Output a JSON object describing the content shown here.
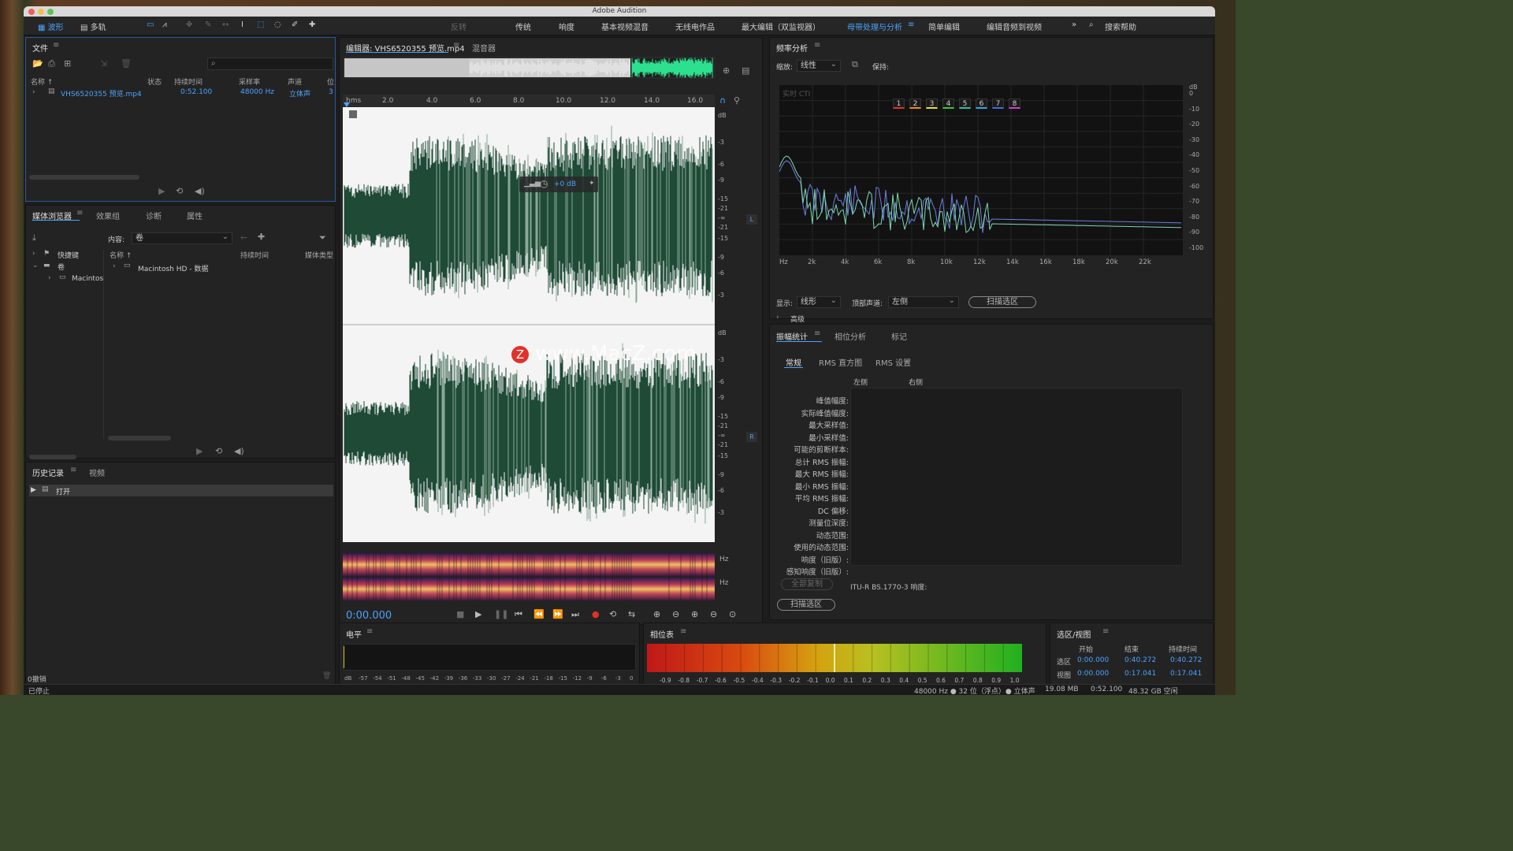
{
  "app_title": "Adobe Audition",
  "toolbar": {
    "waveform_label": "波形",
    "multitrack_label": "多轨",
    "reverse_label": "反转",
    "workspaces": [
      "传统",
      "响度",
      "基本视频混音",
      "无线电作品",
      "最大编辑（双监视器）",
      "母带处理与分析",
      "简单编辑",
      "编辑音频到视频"
    ],
    "active_workspace": "母带处理与分析",
    "overflow": "»",
    "search_placeholder": "搜索帮助"
  },
  "files_panel": {
    "title": "文件",
    "columns": [
      "名称 ↑",
      "状态",
      "持续时间",
      "采样率",
      "声道",
      "位"
    ],
    "rows": [
      {
        "name": "VHS6520355 预览.mp4",
        "status": "",
        "duration": "0:52.100",
        "rate": "48000 Hz",
        "channels": "立体声",
        "bits": "3"
      }
    ]
  },
  "media_browser": {
    "tabs": [
      "媒体浏览器",
      "效果组",
      "诊断",
      "属性"
    ],
    "content_label": "内容:",
    "content_value": "卷",
    "left_tree": [
      "快捷键",
      "卷",
      "Macintos"
    ],
    "columns": [
      "名称 ↑",
      "持续时间",
      "媒体类型"
    ],
    "rows": [
      "Macintosh HD - 数据"
    ]
  },
  "history_panel": {
    "tabs": [
      "历史记录",
      "视频"
    ],
    "items": [
      "打开"
    ],
    "undo_status": "0撤销"
  },
  "editor": {
    "tab_label": "编辑器: VHS6520355 预览.mp4",
    "mixer_tab": "混音器",
    "ruler_unit": "hms",
    "ruler_ticks": [
      "2.0",
      "4.0",
      "6.0",
      "8.0",
      "10.0",
      "12.0",
      "14.0",
      "16.0"
    ],
    "db_scale_top": [
      "dB",
      "-3",
      "-6",
      "-9",
      "-15",
      "-21",
      "-∞",
      "-21",
      "-15",
      "-9",
      "-6",
      "-3"
    ],
    "db_scale_bottom": [
      "dB",
      "-3",
      "-6",
      "-9",
      "-15",
      "-21",
      "-∞",
      "-21",
      "-15",
      "-9",
      "-6",
      "-3"
    ],
    "hud_gain": "+0 dB",
    "channel_left": "L",
    "channel_right": "R",
    "spectral_label": "Hz",
    "watermark": "www.MacZ.com",
    "timecode": "0:00.000"
  },
  "freq_analysis": {
    "title": "频率分析",
    "zoom_label": "缩放:",
    "zoom_value": "线性",
    "keep_label": "保持:",
    "keep_slots": [
      "1",
      "2",
      "3",
      "4",
      "5",
      "6",
      "7",
      "8"
    ],
    "keep_colors": [
      "#e0322b",
      "#f08a1c",
      "#e8e02a",
      "#42c23a",
      "#2fbfa6",
      "#2fa8e8",
      "#3a6fe0",
      "#d23ad8"
    ],
    "realtime_label": "实时 CTI",
    "db_ticks": [
      "dB",
      "0",
      "-10",
      "-20",
      "-30",
      "-40",
      "-50",
      "-60",
      "-70",
      "-80",
      "-90",
      "-100"
    ],
    "hz_ticks": [
      "Hz",
      "2k",
      "4k",
      "6k",
      "8k",
      "10k",
      "12k",
      "14k",
      "16k",
      "18k",
      "20k",
      "22k"
    ],
    "display_label": "显示:",
    "display_value": "线形",
    "top_channel_label": "顶部声道:",
    "top_channel_value": "左侧",
    "scan_button": "扫描选区",
    "advanced": "高级"
  },
  "amplitude_stats": {
    "tabs": [
      "振幅统计",
      "相位分析",
      "标记"
    ],
    "subtabs": [
      "常规",
      "RMS 直方图",
      "RMS 设置"
    ],
    "col_left": "左侧",
    "col_right": "右侧",
    "labels": [
      "峰值幅度:",
      "实际峰值幅度:",
      "最大采样值:",
      "最小采样值:",
      "可能的剪断样本:",
      "总计 RMS 振幅:",
      "最大 RMS 振幅:",
      "最小 RMS 振幅:",
      "平均 RMS 振幅:",
      "DC 偏移:",
      "测量位深度:",
      "动态范围:",
      "使用的动态范围:",
      "响度（旧版）:",
      "感知响度（旧版）:"
    ],
    "copy_all": "全部复制",
    "itu_label": "ITU-R BS.1770-3 响度:",
    "scan_button": "扫描选区"
  },
  "level_meter": {
    "title": "电平",
    "ticks": [
      "dB",
      "-57",
      "-54",
      "-51",
      "-48",
      "-45",
      "-42",
      "-39",
      "-36",
      "-33",
      "-30",
      "-27",
      "-24",
      "-21",
      "-18",
      "-15",
      "-12",
      "-9",
      "-6",
      "-3",
      "0"
    ]
  },
  "phase_meter": {
    "title": "相位表",
    "ticks": [
      "-0.9",
      "-0.8",
      "-0.7",
      "-0.6",
      "-0.5",
      "-0.4",
      "-0.3",
      "-0.2",
      "-0.1",
      "0.0",
      "0.1",
      "0.2",
      "0.3",
      "0.4",
      "0.5",
      "0.6",
      "0.7",
      "0.8",
      "0.9",
      "1.0"
    ]
  },
  "selection_view": {
    "title": "选区/视图",
    "headers": [
      "开始",
      "结束",
      "持续时间"
    ],
    "rows": [
      {
        "label": "选区",
        "start": "0:00.000",
        "end": "0:40.272",
        "duration": "0:40.272"
      },
      {
        "label": "视图",
        "start": "0:00.000",
        "end": "0:17.041",
        "duration": "0:17.041"
      }
    ]
  },
  "status_bar": {
    "state": "已停止",
    "format": "48000 Hz ● 32 位（浮点）● 立体声",
    "size": "19.08 MB",
    "duration": "0:52.100",
    "free": "48.32 GB 空闲"
  }
}
